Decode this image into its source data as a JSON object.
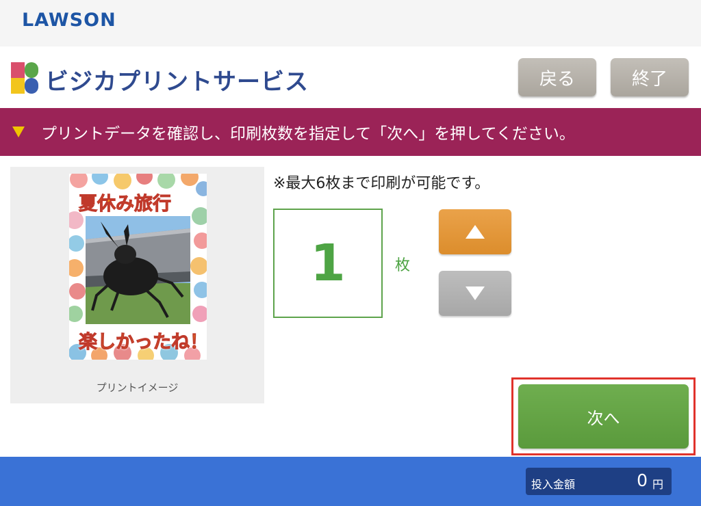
{
  "brand": "LAWSON",
  "service": {
    "title": "ビジカプリントサービス",
    "logo_colors": [
      "#d94f6c",
      "#5aa64a",
      "#f2c51c",
      "#3a5fb0"
    ]
  },
  "buttons": {
    "back": "戻る",
    "end": "終了",
    "next": "次へ"
  },
  "instruction": "プリントデータを確認し、印刷枚数を指定して「次へ」を押してください。",
  "preview": {
    "caption": "プリントイメージ",
    "text_top": "夏休み旅行",
    "text_bottom": "楽しかったね！"
  },
  "quantity": {
    "note": "※最大6枚まで印刷が可能です。",
    "value": "1",
    "unit": "枚",
    "up_icon": "triangle-up-icon",
    "down_icon": "triangle-down-icon"
  },
  "payment": {
    "label": "投入金額",
    "value": "0",
    "unit": "円"
  },
  "colors": {
    "banner": "#9b2357",
    "footer": "#3a72d6",
    "next_button": "#5a9a3c",
    "up_button": "#e0922f",
    "highlight_frame": "#e0322b"
  }
}
